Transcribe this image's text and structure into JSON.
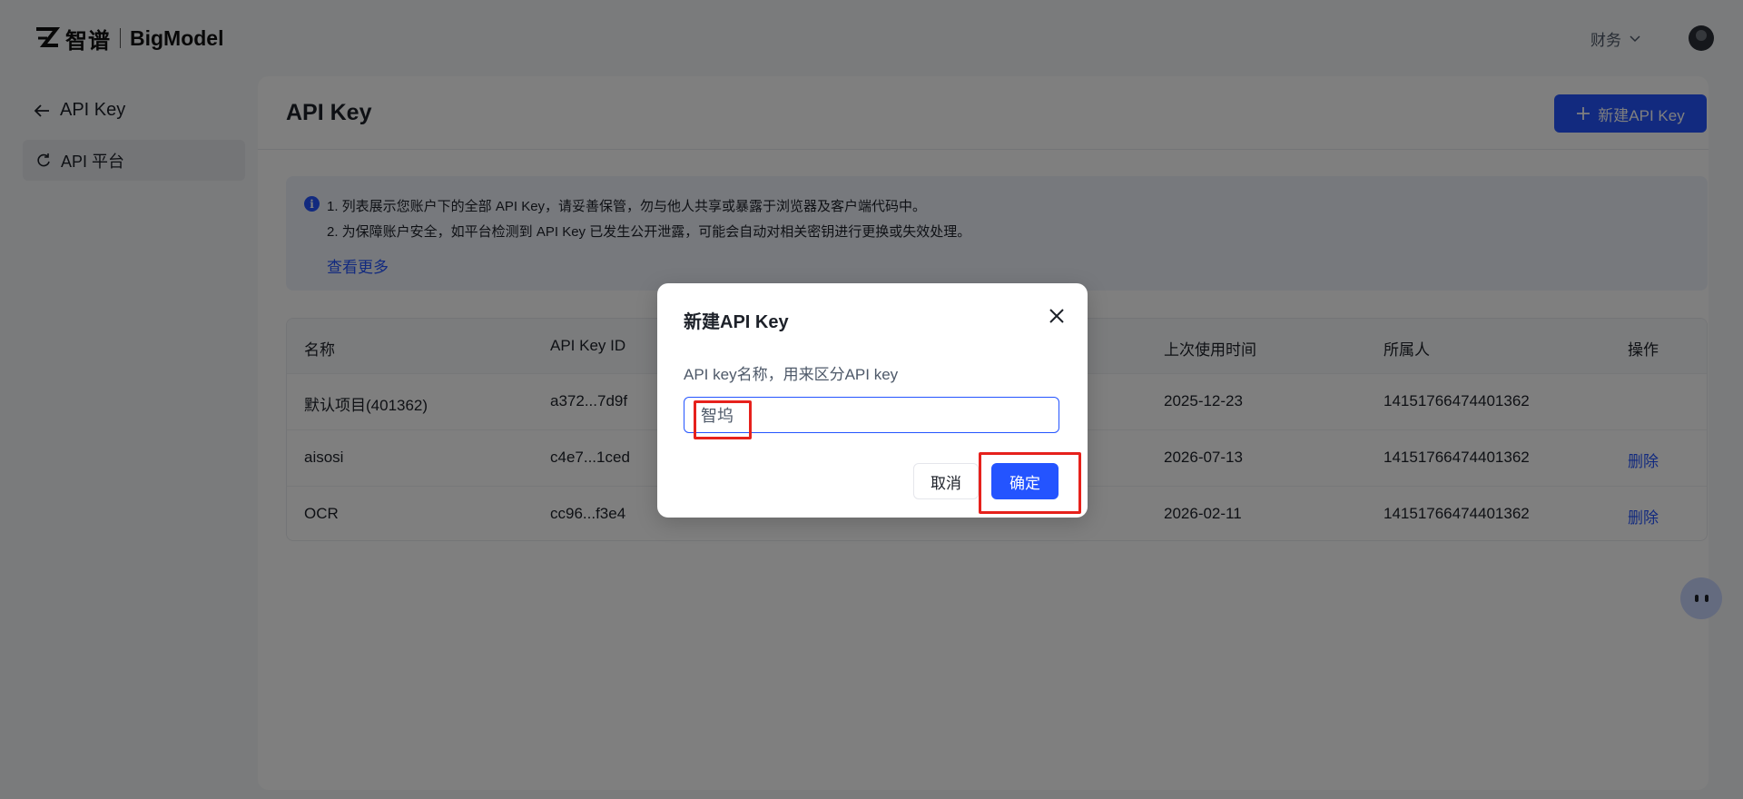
{
  "header": {
    "logo_cn": "智谱",
    "logo_en": "BigModel",
    "finance_label": "财务"
  },
  "sidebar": {
    "back_label": "API Key",
    "items": [
      {
        "label": "API 平台"
      }
    ]
  },
  "main": {
    "title": "API Key",
    "new_button_label": "新建API Key",
    "notice": {
      "lines": [
        "1. 列表展示您账户下的全部 API Key，请妥善保管，勿与他人共享或暴露于浏览器及客户端代码中。",
        "2. 为保障账户安全，如平台检测到 API Key 已发生公开泄露，可能会自动对相关密钥进行更换或失效处理。"
      ],
      "link": "查看更多"
    },
    "table": {
      "columns": [
        "名称",
        "API Key ID",
        "上次使用时间",
        "所属人",
        "操作"
      ],
      "rows": [
        {
          "name": "默认项目(401362)",
          "key_id": "a372...7d9f",
          "last_used": "2025-12-23",
          "owner": "14151766474401362",
          "action": ""
        },
        {
          "name": "aisosi",
          "key_id": "c4e7...1ced",
          "last_used": "2026-07-13",
          "owner": "14151766474401362",
          "action": "删除"
        },
        {
          "name": "OCR",
          "key_id": "cc96...f3e4",
          "last_used": "2026-02-11",
          "owner": "14151766474401362",
          "action": "删除"
        }
      ]
    }
  },
  "dialog": {
    "title": "新建API Key",
    "label": "API key名称，用来区分API key",
    "input_value": "智坞",
    "cancel_label": "取消",
    "ok_label": "确定"
  },
  "colors": {
    "accent": "#2454ff",
    "highlight": "#e6211c",
    "overlay": "rgba(0,0,0,0.5)"
  }
}
